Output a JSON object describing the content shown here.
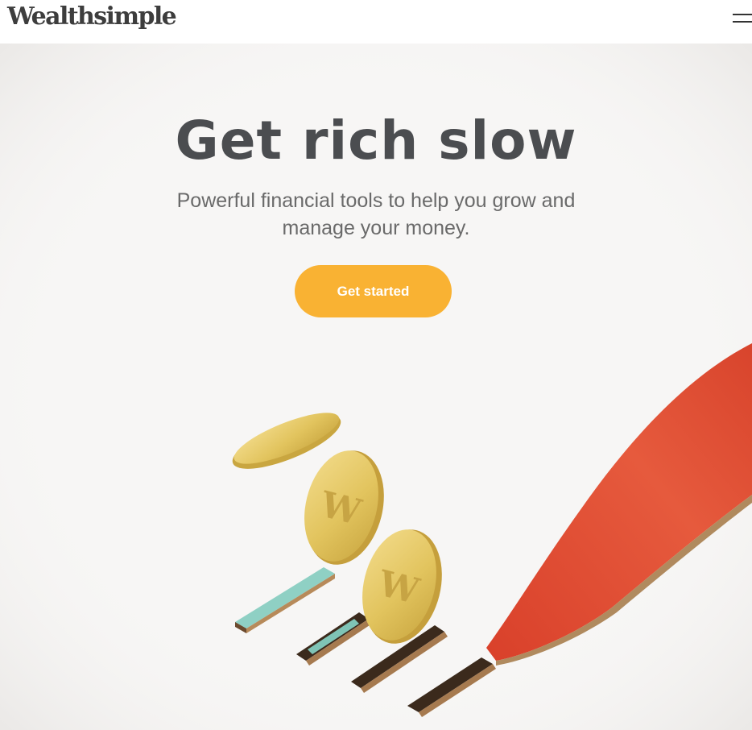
{
  "header": {
    "logo_text": "Wealthsimple"
  },
  "hero": {
    "title": "Get rich slow",
    "subtitle": "Powerful financial tools to help you grow and manage your money.",
    "cta_label": "Get started"
  },
  "colors": {
    "accent": "#f9b233",
    "heading": "#4b4d50",
    "hero_bg": "#f7f6f5",
    "ribbon": "#e04a2e",
    "teal_bar": "#8fd0c4",
    "coin": "#e6c865"
  }
}
